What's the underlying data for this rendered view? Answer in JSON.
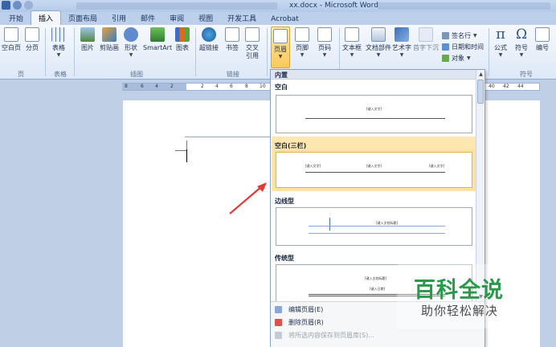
{
  "window": {
    "title": "xx.docx - Microsoft Word"
  },
  "tabs": [
    {
      "label": "开始",
      "active": false
    },
    {
      "label": "插入",
      "active": true
    },
    {
      "label": "页面布局",
      "active": false
    },
    {
      "label": "引用",
      "active": false
    },
    {
      "label": "邮件",
      "active": false
    },
    {
      "label": "审阅",
      "active": false
    },
    {
      "label": "视图",
      "active": false
    },
    {
      "label": "开发工具",
      "active": false
    },
    {
      "label": "Acrobat",
      "active": false
    }
  ],
  "ribbon": {
    "buttons": {
      "cover": "空白页",
      "page": "分页",
      "table": "表格",
      "picture": "图片",
      "clipart": "剪贴画",
      "shape": "形状",
      "smartart": "SmartArt",
      "chart": "图表",
      "hyperlink": "超链接",
      "bookmark": "书签",
      "crossref_1": "交叉",
      "crossref_2": "引用",
      "header": "页眉",
      "footer": "页脚",
      "pagenum": "页码",
      "textbox": "文本框",
      "docparts": "文档部件",
      "wordart": "艺术字",
      "dropcap": "首字下沉",
      "equation": "公式",
      "symbol": "符号",
      "number": "编号"
    },
    "small_buttons": {
      "signature": "签名行",
      "datetime": "日期和时间",
      "object": "对象"
    },
    "groups": {
      "pages": "页",
      "tables": "表格",
      "illustrations": "插图",
      "links": "链接",
      "symbols": "符号"
    }
  },
  "ruler": {
    "ticks": [
      "8",
      "6",
      "4",
      "2",
      "2",
      "4",
      "6",
      "8",
      "10",
      "40",
      "42",
      "44"
    ]
  },
  "dropdown": {
    "header": "内置",
    "sections": [
      {
        "name": "空白",
        "placeholders": [
          "[键入文字]"
        ]
      },
      {
        "name": "空白(三栏)",
        "placeholders": [
          "[键入文字]",
          "[键入文字]",
          "[键入文字]"
        ]
      },
      {
        "name": "边线型",
        "placeholders": [
          "[键入文档标题]"
        ]
      },
      {
        "name": "传统型",
        "placeholders": [
          "[键入文档标题]",
          "[键入日期]"
        ]
      }
    ],
    "menu": [
      {
        "label": "编辑页眉(E)",
        "enabled": true
      },
      {
        "label": "删除页眉(R)",
        "enabled": true
      },
      {
        "label": "将所选内容保存到页眉库(S)...",
        "enabled": false
      }
    ]
  },
  "watermark": {
    "big": "百科全说",
    "small": "助你轻松解决"
  },
  "colors": {
    "accent": "#f9c95b",
    "ribbon": "#dde8f7",
    "arrow": "#e53935",
    "watermark": "#2a9a4a"
  }
}
